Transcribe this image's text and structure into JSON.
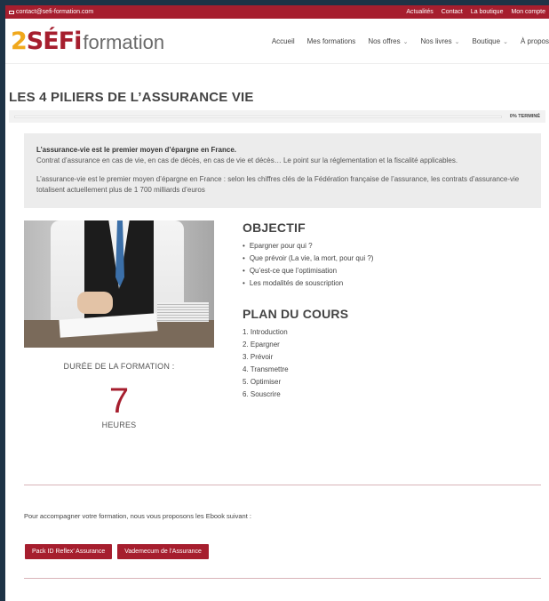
{
  "topbar": {
    "email": "contact@sefi-formation.com",
    "links": [
      "Actualités",
      "Contact",
      "La boutique",
      "Mon compte"
    ]
  },
  "logo": {
    "mark": "SÉFi",
    "word": "formation"
  },
  "nav": {
    "items": [
      {
        "label": "Accueil",
        "dropdown": false
      },
      {
        "label": "Mes formations",
        "dropdown": false
      },
      {
        "label": "Nos offres",
        "dropdown": true
      },
      {
        "label": "Nos livres",
        "dropdown": true
      },
      {
        "label": "Boutique",
        "dropdown": true
      },
      {
        "label": "À propos",
        "dropdown": false
      }
    ]
  },
  "page": {
    "title": "LES 4 PILIERS DE L’ASSURANCE VIE",
    "progress_percent": 0,
    "progress_label": "0% TERMINÉ"
  },
  "intro": {
    "lead": "L’assurance-vie est le premier moyen d’épargne en France.",
    "line2": "Contrat d’assurance en cas de vie, en cas de décès, en cas de vie et décès… Le point sur la réglementation et la fiscalité applicables.",
    "para2": "L’assurance-vie est le premier moyen d’épargne en France : selon les chiffres clés de la Fédération française de l’assurance, les contrats d’assurance-vie totalisent actuellement plus de 1 700 milliards d’euros"
  },
  "duration": {
    "label": "DURÉE DE LA FORMATION :",
    "value": "7",
    "unit": "HEURES"
  },
  "objectif": {
    "title": "OBJECTIF",
    "items": [
      "Epargner pour qui ?",
      "Que prévoir (La vie, la mort, pour qui ?)",
      "Qu’est-ce que l’optimisation",
      "Les modalités de souscription"
    ]
  },
  "plan": {
    "title": "PLAN DU COURS",
    "items": [
      "1. Introduction",
      "2. Epargner",
      "3. Prévoir",
      "4. Transmettre",
      "5. Optimiser",
      "6. Souscrire"
    ]
  },
  "ebook": {
    "text": "Pour accompagner votre formation, nous vous proposons les Ebook suivant :",
    "buttons": [
      "Pack ID Reflex’ Assurance",
      "Vademecum de l’Assurance"
    ]
  },
  "colors": {
    "brand_red": "#a61e2e",
    "brand_yellow": "#f0a81c",
    "frame_bg": "#1e3346"
  }
}
